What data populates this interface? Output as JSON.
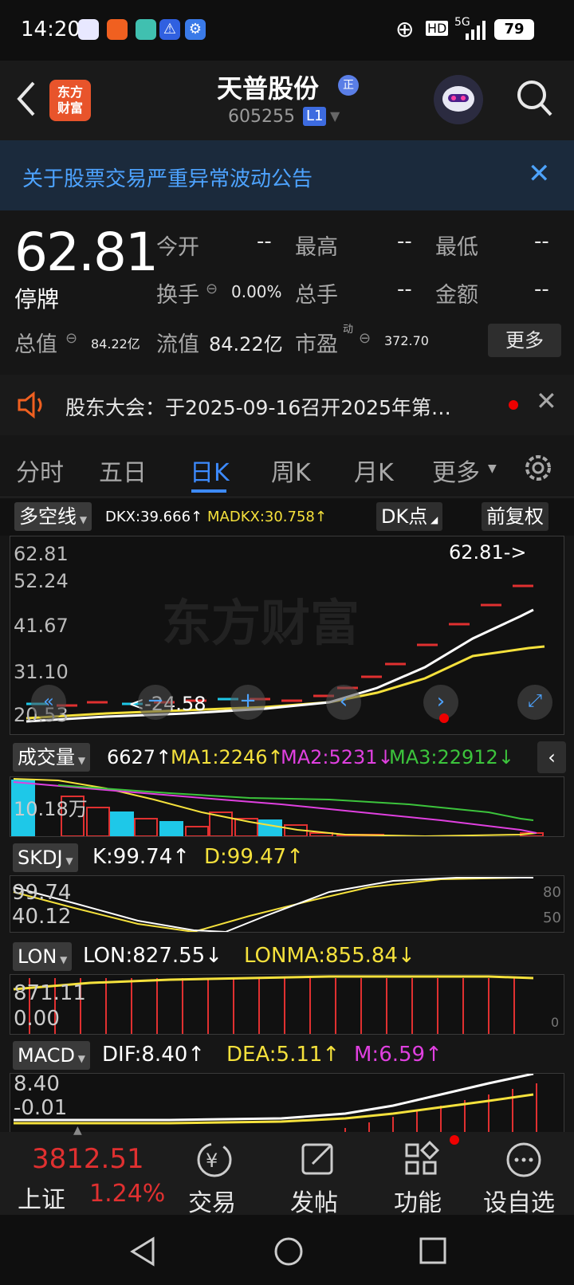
{
  "status_bar": {
    "time": "14:20",
    "signal": "5G",
    "battery": "79",
    "hd": "HD"
  },
  "header": {
    "logo_text_1": "东方",
    "logo_text_2": "财富",
    "stock_name": "天普股份",
    "badge": "正",
    "code": "605255",
    "level": "L1"
  },
  "notice": {
    "text": "关于股票交易严重异常波动公告"
  },
  "quote": {
    "price": "62.81",
    "status": "停牌",
    "open_label": "今开",
    "open": "--",
    "high_label": "最高",
    "high": "--",
    "low_label": "最低",
    "low": "--",
    "turnover_label": "换手",
    "turnover": "0.00%",
    "volume_label": "总手",
    "volume": "--",
    "amount_label": "金额",
    "amount": "--",
    "mktcap_label": "总值",
    "mktcap": "84.22亿",
    "float_label": "流值",
    "float": "84.22亿",
    "pe_label": "市盈",
    "pe_sup": "动",
    "pe": "372.70",
    "more": "更多"
  },
  "announcement": {
    "text": "股东大会：于2025-09-16召开2025年第…"
  },
  "tabs": [
    "分时",
    "五日",
    "日K",
    "周K",
    "月K",
    "更多"
  ],
  "active_tab": 2,
  "kline_bar": {
    "indicator": "多空线",
    "dkx": "DKX:39.666↑",
    "madkx": "MADKX:30.758↑",
    "dk_point": "DK点",
    "adjust": "前复权"
  },
  "kline": {
    "y_labels": [
      "62.81",
      "52.24",
      "41.67",
      "31.10",
      "20.53"
    ],
    "last_label": "62.81->",
    "low_label": "<-24.58",
    "watermark": "东方财富"
  },
  "volume_panel": {
    "indicator": "成交量",
    "val": "6627↑",
    "ma1": "MA1:2246↑",
    "ma2": "MA2:5231↓",
    "ma3": "MA3:22912↓",
    "max_label": "10.18万"
  },
  "skdj_panel": {
    "indicator": "SKDJ",
    "k": "K:99.74↑",
    "d": "D:99.47↑",
    "y_top": "99.74",
    "y_bot": "40.12",
    "r80": "80",
    "r50": "50"
  },
  "lon_panel": {
    "indicator": "LON",
    "lon": "LON:827.55↓",
    "lonma": "LONMA:855.84↓",
    "y_top": "871.11",
    "y_bot": "0.00",
    "r0": "0"
  },
  "macd_panel": {
    "indicator": "MACD",
    "dif": "DIF:8.40↑",
    "dea": "DEA:5.11↑",
    "m": "M:6.59↑",
    "y_top": "8.40",
    "y_bot": "-0.01"
  },
  "bottom_bar": {
    "index_value": "3812.51",
    "index_name": "上证",
    "index_change": "1.24%",
    "trade": "交易",
    "post": "发帖",
    "function": "功能",
    "watchlist": "设自选"
  },
  "colors": {
    "up": "#e03030",
    "down": "#1ec8e8",
    "accent": "#3d8bff",
    "yellow": "#f5e13c",
    "magenta": "#e040e0",
    "green": "#3cc43c"
  }
}
